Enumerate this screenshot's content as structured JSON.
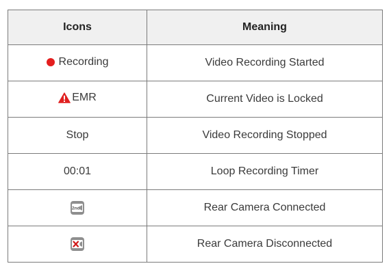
{
  "header": {
    "icons": "Icons",
    "meaning": "Meaning"
  },
  "rows": [
    {
      "icon_text": "Recording",
      "icon": "red-dot-icon",
      "meaning": "Video Recording Started"
    },
    {
      "icon_text": "EMR",
      "icon": "warning-triangle-icon",
      "meaning": "Current Video is Locked"
    },
    {
      "icon_text": "Stop",
      "meaning": "Video Recording Stopped"
    },
    {
      "icon_text": "00:01",
      "meaning": "Loop Recording Timer"
    },
    {
      "icon": "rear-camera-connected-icon",
      "badge_text": "2nd",
      "meaning": "Rear Camera Connected"
    },
    {
      "icon": "rear-camera-disconnected-icon",
      "meaning": "Rear Camera Disconnected"
    }
  ],
  "colors": {
    "record_red": "#e41e1e",
    "warning_red": "#e02020",
    "badge_gray": "#8e8e8e",
    "border": "#7a7a7a",
    "header_bg": "#f0f0f0"
  }
}
